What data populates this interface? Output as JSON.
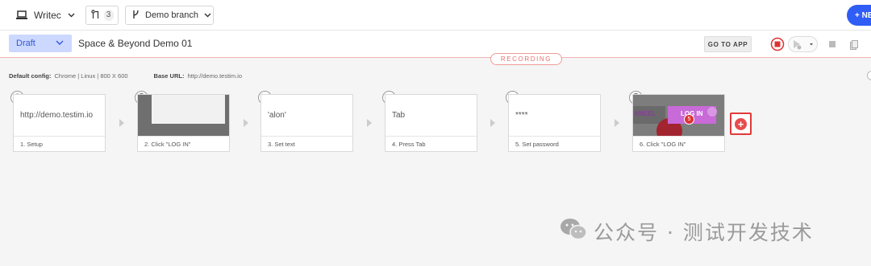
{
  "topbar": {
    "project_name": "Writec",
    "pr_count": "3",
    "branch_name": "Demo branch",
    "new_button_label": "+ NE"
  },
  "test": {
    "status": "Draft",
    "name": "Space & Beyond Demo 01",
    "goto_app_label": "GO TO APP",
    "recording_label": "RECORDING"
  },
  "config": {
    "default_config_label": "Default config:",
    "default_config_value": "Chrome | Linux | 800 X 600",
    "base_url_label": "Base URL:",
    "base_url_value": "http://demo.testim.io"
  },
  "steps": [
    {
      "label": "1. Setup",
      "preview": "http://demo.testim.io",
      "icon": "globe-icon"
    },
    {
      "label": "2. Click \"LOG IN\"",
      "preview": "",
      "icon": "mouse-icon"
    },
    {
      "label": "3. Set text",
      "preview": "'alon'",
      "icon": "keyboard-icon"
    },
    {
      "label": "4. Press Tab",
      "preview": "Tab",
      "icon": "keyboard-icon"
    },
    {
      "label": "5. Set password",
      "preview": "****",
      "icon": "keyboard-icon"
    },
    {
      "label": "6. Click \"LOG IN\"",
      "preview": "",
      "icon": "mouse-icon",
      "shot_texts": {
        "cancel": "ANCEL",
        "login": "LOG IN",
        "badge": "5"
      }
    }
  ],
  "watermark": {
    "text": "公众号 · 测试开发技术"
  },
  "colors": {
    "accent_blue": "#2f5df5",
    "draft_bg": "#ccd8ff",
    "recording_red": "#e87070",
    "add_step_red": "#e03a3a"
  }
}
